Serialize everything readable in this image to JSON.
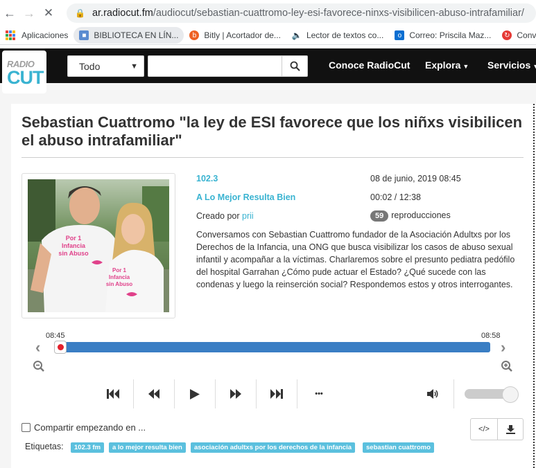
{
  "browser": {
    "url_host": "ar.radiocut.fm",
    "url_path": "/audiocut/sebastian-cuattromo-ley-esi-favorece-ninxs-visibilicen-abuso-intrafamiliar/",
    "bookmarks": [
      {
        "label": "Aplicaciones",
        "icon": "apps-grid-icon"
      },
      {
        "label": "BIBLIOTECA EN LÍN...",
        "icon": "library-icon"
      },
      {
        "label": "Bitly | Acortador de...",
        "icon": "bitly-icon"
      },
      {
        "label": "Lector de textos co...",
        "icon": "speaker-icon"
      },
      {
        "label": "Correo: Priscila Maz...",
        "icon": "outlook-icon"
      },
      {
        "label": "Conv",
        "icon": "convert-icon"
      }
    ]
  },
  "site": {
    "logo_top": "RADIO",
    "logo_bottom": "CUT",
    "search_scope": "Todo",
    "search_placeholder": "",
    "nav": [
      "Conoce RadioCut",
      "Explora",
      "Servicios"
    ]
  },
  "audio": {
    "title": "Sebastian Cuattromo \"la ley de ESI favorece que los niñxs visibilicen el abuso intrafamiliar\"",
    "station": "102.3",
    "date": "08 de junio, 2019 08:45",
    "program": "A Lo Mejor Resulta Bien",
    "position": "00:02 / 12:38",
    "created_by_label": "Creado por",
    "creator": "prii",
    "plays_count": "59",
    "plays_label": "reproducciones",
    "description": "Conversamos con Sebastian Cuattromo fundador de la Asociación Adultxs por los Derechos de la Infancia, una ONG que busca visibilizar los casos de abuso sexual infantil y acompañar a la víctimas. Charlaremos sobre el presunto pediatra pedófilo del hospital Garrahan ¿Cómo pude actuar el Estado? ¿Qué sucede con las condenas y luego la reinserción social? Respondemos estos y otros interrogantes.",
    "photo_shirt_text_1": "Por 1 Infancia sin Abuso",
    "photo_shirt_text_2": "Por 1 Infancia sin Abuso"
  },
  "player": {
    "start_time": "08:45",
    "end_time": "08:58",
    "progress_fraction": 0.003,
    "volume_fraction": 1.0,
    "more_label": "•••"
  },
  "footer": {
    "share_label": "Compartir empezando en ...",
    "tags_label": "Etiquetas:",
    "tags": [
      "102.3 fm",
      "a lo mejor resulta bien",
      "asociación adultxs por los derechos de la infancia",
      "sebastian cuattromo"
    ]
  },
  "colors": {
    "accent": "#39b3d1",
    "track": "#3a7ec4",
    "navbar": "#111111",
    "tag": "#5bc0de"
  }
}
